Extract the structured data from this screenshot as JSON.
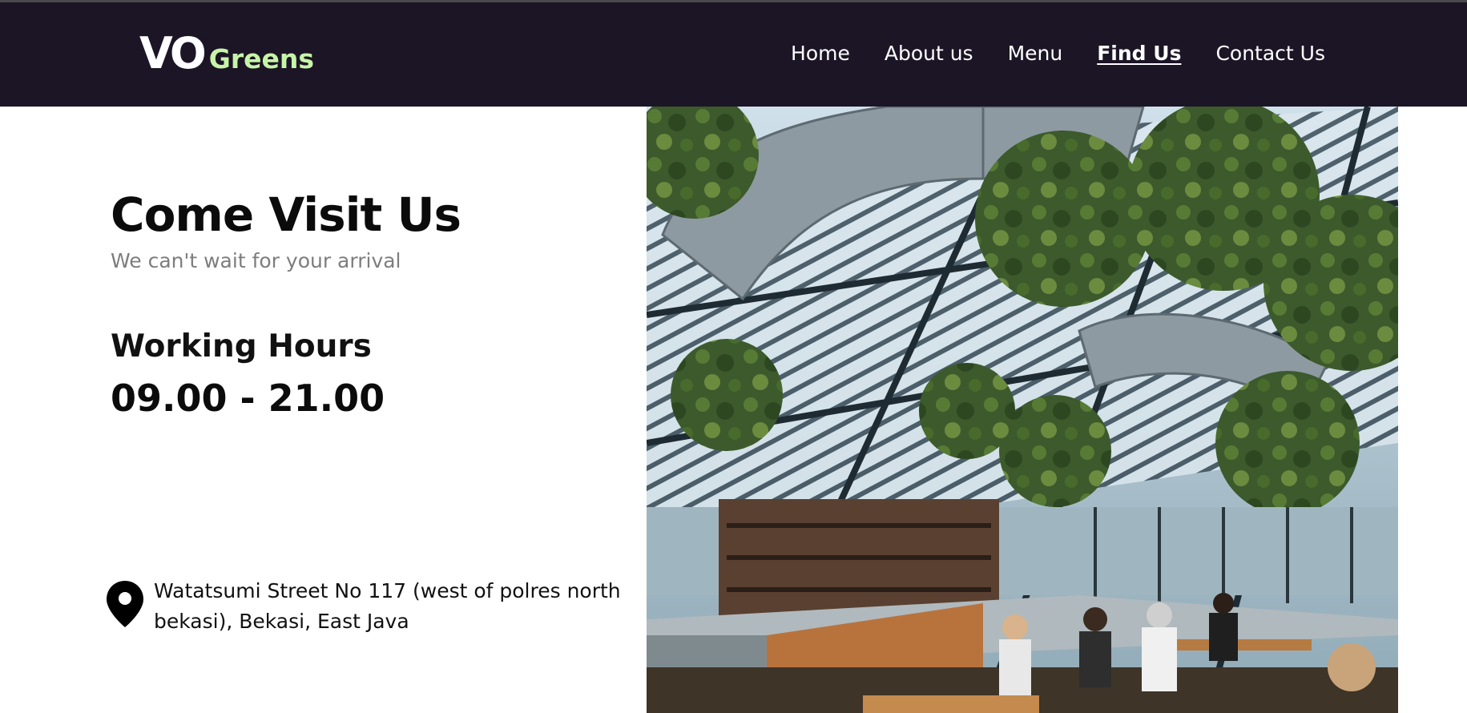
{
  "header": {
    "logo": {
      "part1": "VO",
      "part2": "Greens"
    },
    "nav": [
      {
        "label": "Home",
        "active": false
      },
      {
        "label": "About us",
        "active": false
      },
      {
        "label": "Menu",
        "active": false
      },
      {
        "label": "Find Us",
        "active": true
      },
      {
        "label": "Contact Us",
        "active": false
      }
    ]
  },
  "main": {
    "title": "Come Visit Us",
    "subtitle": "We can't wait for your arrival",
    "hours_label": "Working Hours",
    "hours_value": "09.00 - 21.00",
    "address": "Watatsumi Street No 117 (west of polres north bekasi), Bekasi, East Java",
    "address_icon": "map-pin-icon",
    "photo_subject": "greenhouse-cafe-photo"
  },
  "colors": {
    "header_bg": "#1c1526",
    "logo_accent": "#c7f5a8",
    "text_dark": "#0b0b0b",
    "text_muted": "#7d7d7d"
  }
}
